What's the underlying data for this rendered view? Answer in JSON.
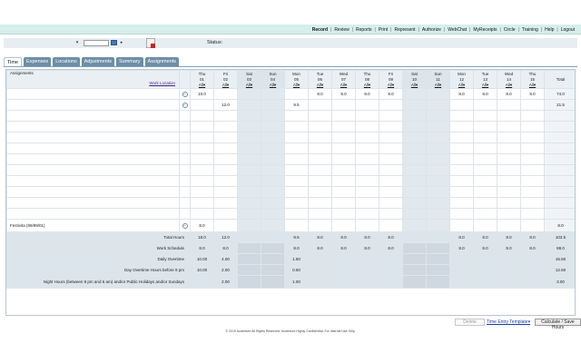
{
  "nav": {
    "items": [
      "Record",
      "Review",
      "Reports",
      "Print",
      "Represent",
      "Authorize",
      "WebChat",
      "MyReceipts",
      "Circle",
      "Training",
      "Help",
      "Logout"
    ],
    "active": "Record"
  },
  "controls": {
    "period_value": "",
    "status_label": "Status:"
  },
  "tabs": [
    "Time",
    "Expenses",
    "Locations",
    "Adjustments",
    "Summary",
    "Assignments"
  ],
  "grid": {
    "assignments_label": "Assignments",
    "work_location_label": "Work Location",
    "all_label": "All",
    "total_label": "Total",
    "days": [
      {
        "name": "Thu",
        "date": "01",
        "weekend": false
      },
      {
        "name": "Fri",
        "date": "02",
        "weekend": false
      },
      {
        "name": "Sat",
        "date": "03",
        "weekend": true
      },
      {
        "name": "Sun",
        "date": "04",
        "weekend": true
      },
      {
        "name": "Mon",
        "date": "05",
        "weekend": false
      },
      {
        "name": "Tue",
        "date": "06",
        "weekend": false
      },
      {
        "name": "Wed",
        "date": "07",
        "weekend": false
      },
      {
        "name": "Thu",
        "date": "08",
        "weekend": false
      },
      {
        "name": "Fri",
        "date": "09",
        "weekend": false
      },
      {
        "name": "Sat",
        "date": "10",
        "weekend": true
      },
      {
        "name": "Sun",
        "date": "11",
        "weekend": true
      },
      {
        "name": "Mon",
        "date": "12",
        "weekend": false
      },
      {
        "name": "Tue",
        "date": "13",
        "weekend": false
      },
      {
        "name": "Wed",
        "date": "14",
        "weekend": false
      },
      {
        "name": "Thu",
        "date": "15",
        "weekend": false
      }
    ],
    "rows": [
      {
        "assignment": "",
        "expand": true,
        "values": [
          "10.0",
          "",
          "",
          "",
          "",
          "8.0",
          "8.0",
          "8.0",
          "8.0",
          "",
          "",
          "8.0",
          "8.0",
          "8.0",
          "8.0"
        ],
        "total": "74.0"
      },
      {
        "assignment": "",
        "expand": true,
        "values": [
          "",
          "12.0",
          "",
          "",
          "9.5",
          "",
          "",
          "",
          "",
          "",
          "",
          "",
          "",
          "",
          ""
        ],
        "total": "21.5"
      },
      {
        "assignment": "",
        "expand": false,
        "values": [
          "",
          "",
          "",
          "",
          "",
          "",
          "",
          "",
          "",
          "",
          "",
          "",
          "",
          "",
          ""
        ],
        "total": ""
      },
      {
        "assignment": "",
        "expand": false,
        "values": [
          "",
          "",
          "",
          "",
          "",
          "",
          "",
          "",
          "",
          "",
          "",
          "",
          "",
          "",
          ""
        ],
        "total": ""
      },
      {
        "assignment": "",
        "expand": false,
        "values": [
          "",
          "",
          "",
          "",
          "",
          "",
          "",
          "",
          "",
          "",
          "",
          "",
          "",
          "",
          ""
        ],
        "total": ""
      },
      {
        "assignment": "",
        "expand": false,
        "values": [
          "",
          "",
          "",
          "",
          "",
          "",
          "",
          "",
          "",
          "",
          "",
          "",
          "",
          "",
          ""
        ],
        "total": ""
      },
      {
        "assignment": "",
        "expand": false,
        "values": [
          "",
          "",
          "",
          "",
          "",
          "",
          "",
          "",
          "",
          "",
          "",
          "",
          "",
          "",
          ""
        ],
        "total": ""
      },
      {
        "assignment": "",
        "expand": false,
        "values": [
          "",
          "",
          "",
          "",
          "",
          "",
          "",
          "",
          "",
          "",
          "",
          "",
          "",
          "",
          ""
        ],
        "total": ""
      },
      {
        "assignment": "",
        "expand": false,
        "values": [
          "",
          "",
          "",
          "",
          "",
          "",
          "",
          "",
          "",
          "",
          "",
          "",
          "",
          "",
          ""
        ],
        "total": ""
      },
      {
        "assignment": "",
        "expand": false,
        "values": [
          "",
          "",
          "",
          "",
          "",
          "",
          "",
          "",
          "",
          "",
          "",
          "",
          "",
          "",
          ""
        ],
        "total": ""
      },
      {
        "assignment": "",
        "expand": false,
        "values": [
          "",
          "",
          "",
          "",
          "",
          "",
          "",
          "",
          "",
          "",
          "",
          "",
          "",
          "",
          ""
        ],
        "total": ""
      },
      {
        "assignment": "",
        "expand": false,
        "values": [
          "",
          "",
          "",
          "",
          "",
          "",
          "",
          "",
          "",
          "",
          "",
          "",
          "",
          "",
          ""
        ],
        "total": ""
      },
      {
        "assignment": "Festivita (99/99/01)",
        "expand": true,
        "values": [
          "8.0",
          "",
          "",
          "",
          "",
          "",
          "",
          "",
          "",
          "",
          "",
          "",
          "",
          "",
          ""
        ],
        "total": "8.0"
      }
    ],
    "summary": [
      {
        "label": "Total Hours",
        "values": [
          "18.0",
          "12.0",
          "",
          "",
          "9.5",
          "8.0",
          "8.0",
          "8.0",
          "8.0",
          "",
          "",
          "8.0",
          "8.0",
          "8.0",
          "8.0"
        ],
        "total": "103.5"
      },
      {
        "label": "Work Schedule",
        "values": [
          "8.0",
          "8.0",
          "",
          "",
          "8.0",
          "8.0",
          "8.0",
          "8.0",
          "8.0",
          "",
          "",
          "8.0",
          "8.0",
          "8.0",
          "8.0"
        ],
        "total": "88.0"
      },
      {
        "label": "Daily Overtime",
        "values": [
          "10.00",
          "4.00",
          "",
          "",
          "1.50",
          "",
          "",
          "",
          "",
          "",
          "",
          "",
          "",
          "",
          ""
        ],
        "total": "15.50"
      },
      {
        "label": "Day Overtime Hours before 9 pm",
        "values": [
          "10.00",
          "2.00",
          "",
          "",
          "0.50",
          "",
          "",
          "",
          "",
          "",
          "",
          "",
          "",
          "",
          ""
        ],
        "total": "12.50"
      },
      {
        "label": "Night Hours (between 9 pm and 6 am) and/or Public Holidays and/or Sundays",
        "values": [
          "",
          "2.00",
          "",
          "",
          "1.00",
          "",
          "",
          "",
          "",
          "",
          "",
          "",
          "",
          "",
          ""
        ],
        "total": "3.00"
      }
    ]
  },
  "footer": {
    "delete_label": "Delete",
    "template_label": "Time Entry Template",
    "save_label": "Calculate / Save Hours",
    "copyright": "© 2019 Accenture All Rights Reserved. Accenture Highly Confidential. For Internal Use Only."
  }
}
